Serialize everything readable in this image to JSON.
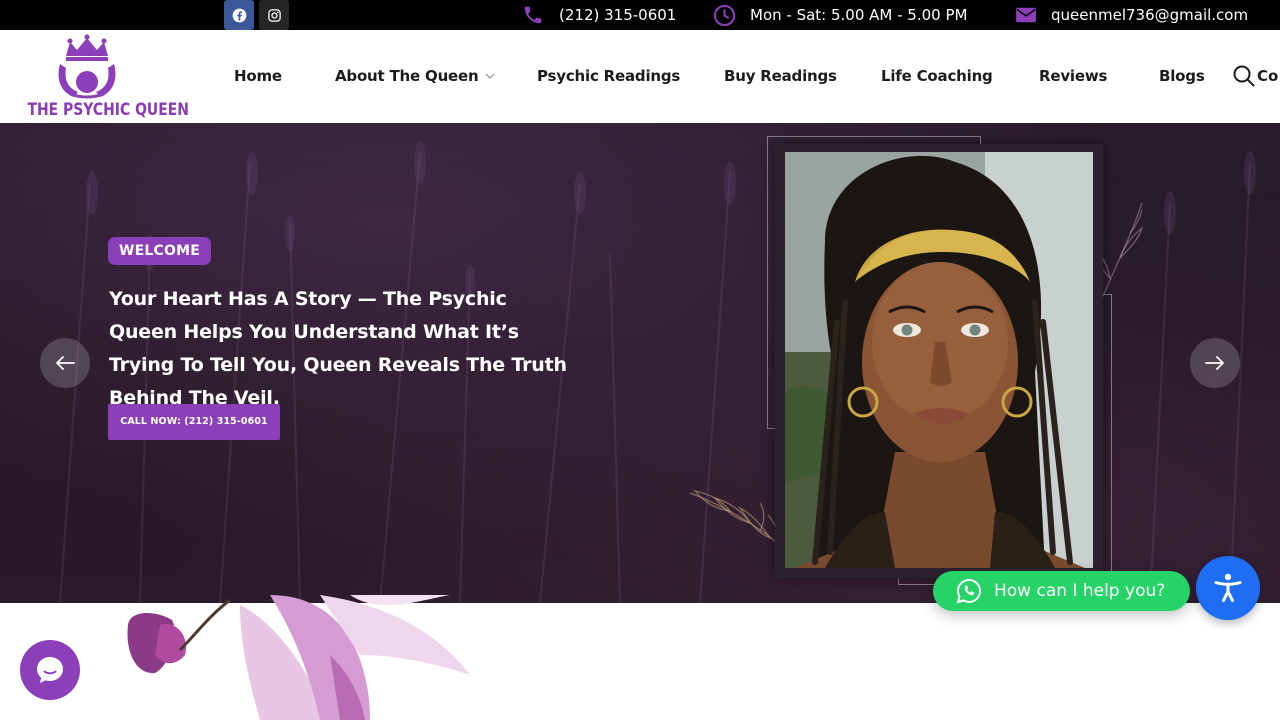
{
  "topbar": {
    "phone": "(212) 315-0601",
    "hours": "Mon - Sat: 5.00 AM - 5.00 PM",
    "email": "queenmel736@gmail.com",
    "socials": [
      "facebook-icon",
      "instagram-icon"
    ]
  },
  "header": {
    "logo_text": "THE PSYCHIC QUEEN",
    "nav": [
      {
        "label": "Home"
      },
      {
        "label": "About The Queen"
      },
      {
        "label": "Psychic Readings"
      },
      {
        "label": "Buy Readings"
      },
      {
        "label": "Life Coaching"
      },
      {
        "label": "Reviews"
      },
      {
        "label": "Blogs"
      }
    ],
    "nav_cut_label": "Co"
  },
  "hero": {
    "badge": "WELCOME",
    "headline": "Your Heart Has A Story — The Psychic Queen Helps You Understand What It’s Trying To Tell You, Queen Reveals The Truth Behind The Veil.",
    "cta": "CALL NOW: (212) 315-0601"
  },
  "widgets": {
    "whatsapp": "How can I help you?"
  },
  "colors": {
    "brand_purple": "#8b3fb8",
    "whatsapp_green": "#25d366",
    "accessibility_blue": "#1e6ef5",
    "topbar_black": "#000000"
  }
}
